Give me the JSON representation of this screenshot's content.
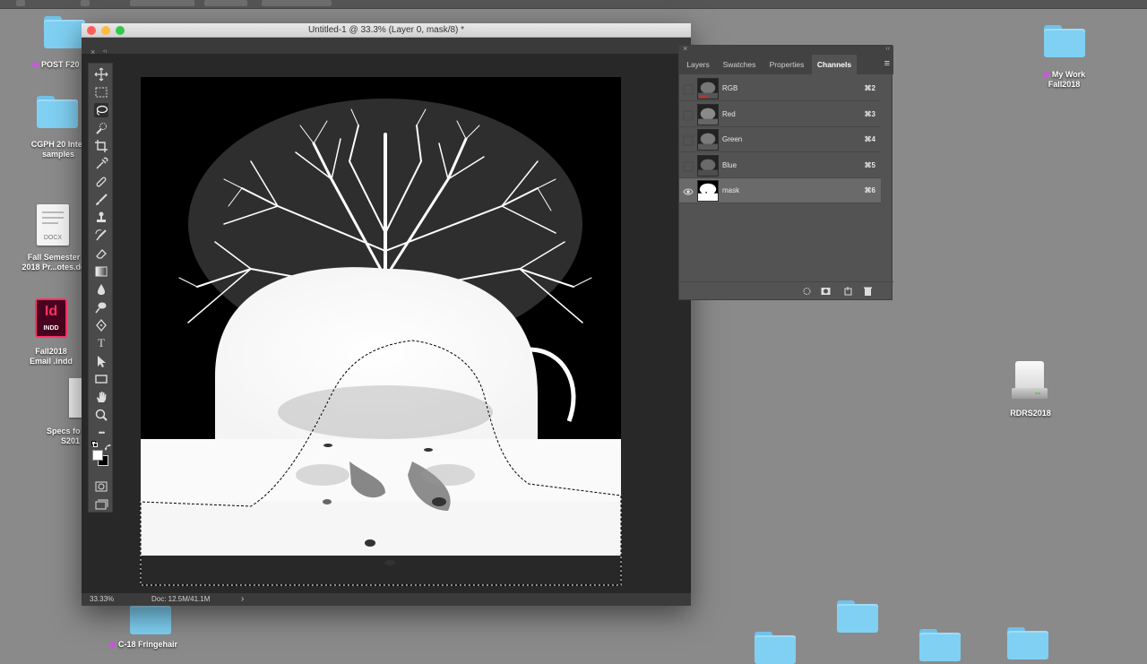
{
  "document": {
    "title": "Untitled-1 @ 33.3% (Layer 0, mask/8) *",
    "zoom": "33.33%",
    "doc_size": "Doc: 12.5M/41.1M",
    "status_arrow": "›"
  },
  "desktop": {
    "post_folder": "POST F20",
    "cgph_line1": "CGPH 20 Inter",
    "cgph_line2": "samples",
    "docx_badge": "DOCX",
    "fall_semester_line1": "Fall Semester",
    "fall_semester_line2": "2018 Pr...otes.do",
    "indd_glyph": "Id",
    "indd_badge": "INDD",
    "fall2018_line1": "Fall2018",
    "fall2018_line2": "Email .indd",
    "specs_line1": "Specs fo",
    "specs_line2": "S201",
    "my_work_line1": "My Work",
    "my_work_line2": "Fall2018",
    "rdrs": "RDRS2018",
    "bottom_label": "C-18 Fringehair"
  },
  "panel": {
    "tabs": [
      "Layers",
      "Swatches",
      "Properties",
      "Channels"
    ],
    "active_tab": "Channels",
    "menu_glyph": "≡",
    "close_glyph": "×",
    "collapse_glyph": "‹‹",
    "channels": [
      {
        "name": "RGB",
        "shortcut": "⌘2",
        "visible": false,
        "selected": false
      },
      {
        "name": "Red",
        "shortcut": "⌘3",
        "visible": false,
        "selected": false
      },
      {
        "name": "Green",
        "shortcut": "⌘4",
        "visible": false,
        "selected": false
      },
      {
        "name": "Blue",
        "shortcut": "⌘5",
        "visible": false,
        "selected": false
      },
      {
        "name": "mask",
        "shortcut": "⌘6",
        "visible": true,
        "selected": true
      }
    ]
  },
  "toolbar": {
    "close_glyph": "×",
    "collapse_glyph": "‹‹",
    "text_tool_glyph": "T",
    "more_tools_glyph": "•••"
  },
  "colors": {
    "desktop_bg": "#8a8a8a",
    "folder_blue": "#7fd0f3",
    "tag_purple": "#c45ad8",
    "panel_bg": "#535353",
    "selected_row": "#6a6a6a",
    "close_red": "#fc605c",
    "minimize_yellow": "#fdbc40",
    "zoom_green": "#34c84a",
    "indesign_pink": "#ff3366"
  }
}
